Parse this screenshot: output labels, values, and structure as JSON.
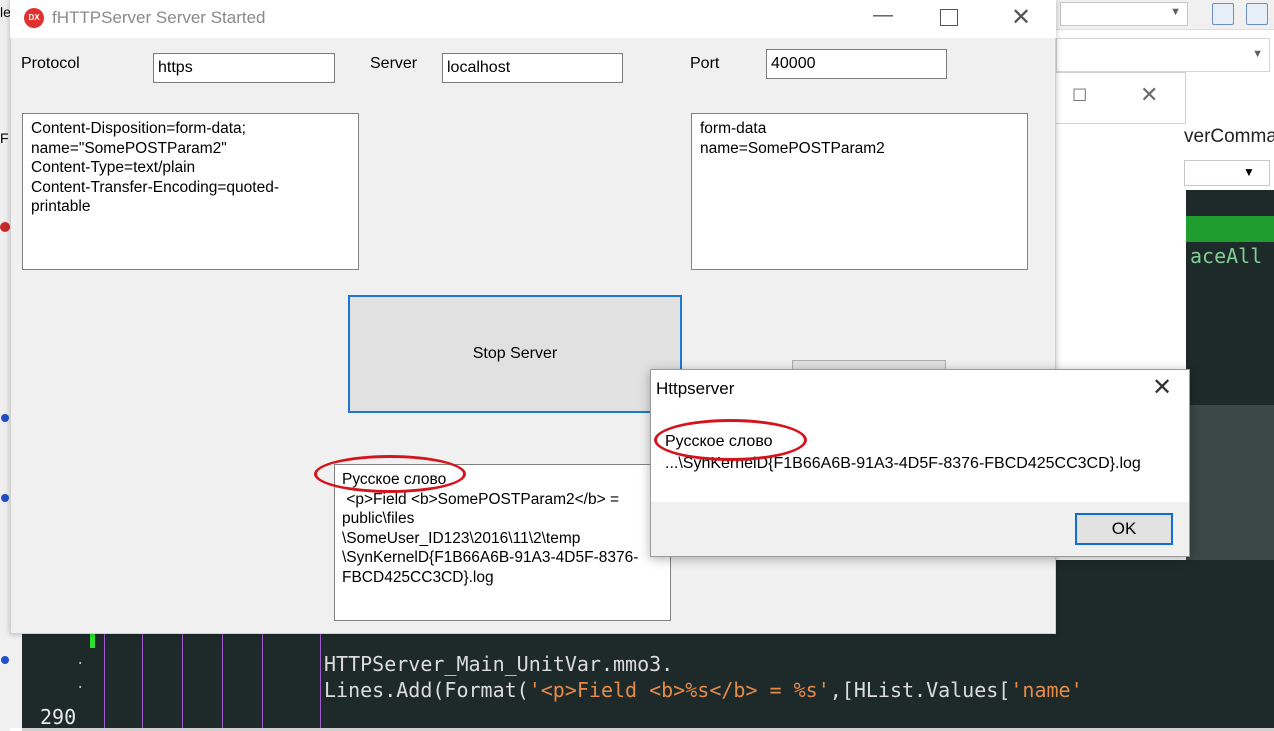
{
  "background_ide": {
    "left_edge_text": "le",
    "left_edge_f": "F",
    "command_text": "verComma",
    "code_right_text": "aceAll",
    "line_number": "290",
    "code_line_1": "HTTPServer_Main_UnitVar.mmo3.",
    "code_line_2_prefix": "Lines.Add(Format(",
    "code_line_2_str": "'<p>Field <b>%s</b> = %s'",
    "code_line_2_mid": ",[HList.Values[",
    "code_line_2_str2": "'name'"
  },
  "main_window": {
    "icon_label": "DX",
    "title": "fHTTPServer Server Started",
    "protocol_label": "Protocol",
    "protocol_value": "https",
    "server_label": "Server",
    "server_value": "localhost",
    "port_label": "Port",
    "port_value": "40000",
    "memo_left": "Content-Disposition=form-data;\nname=\"SomePOSTParam2\"\nContent-Type=text/plain\nContent-Transfer-Encoding=quoted-\nprintable",
    "memo_right": "form-data\nname=SomePOSTParam2",
    "stop_button_label": "Stop Server",
    "memo_bottom": "Русское слово\n <p>Field <b>SomePOSTParam2</b> =\npublic\\files\n\\SomeUser_ID123\\2016\\11\\2\\temp\n\\SynKernelD{F1B66A6B-91A3-4D5F-8376-\nFBCD425CC3CD}.log"
  },
  "dialog": {
    "title": "Httpserver",
    "message_line1": "Русское слово",
    "message_line2": "...\\SynKernelD{F1B66A6B-91A3-4D5F-8376-FBCD425CC3CD}.log",
    "ok_label": "OK"
  },
  "colors": {
    "annotation": "#d4141c",
    "focus_border": "#1e78d2",
    "editor_bg": "#1e2a2a",
    "string_literal": "#e68a4a"
  },
  "icons": [
    "app-dx-icon",
    "minimize-icon",
    "maximize-icon",
    "close-icon",
    "chevron-down-icon"
  ]
}
